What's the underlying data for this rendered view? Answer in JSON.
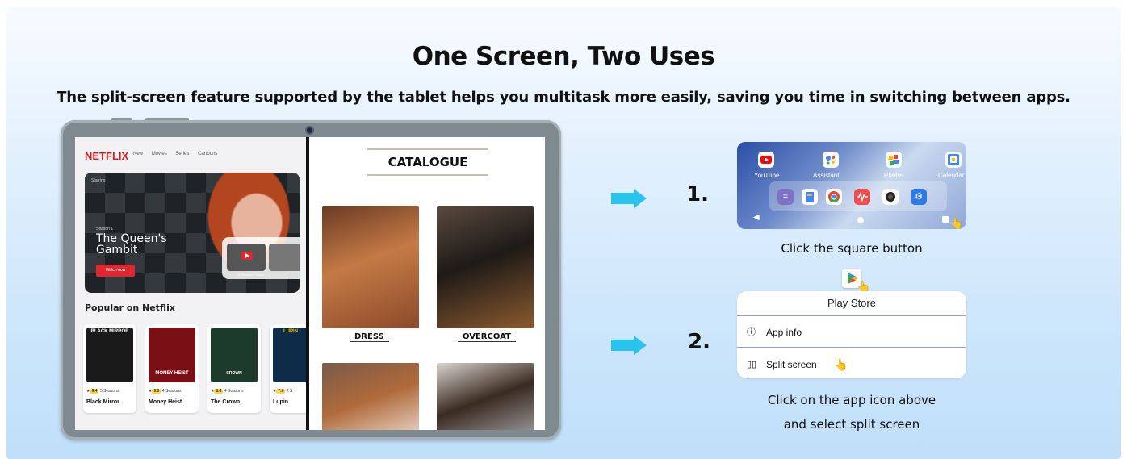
{
  "title": "One Screen, Two Uses",
  "subtitle": "The split-screen feature supported by the tablet helps you multitask more easily, saving you time in switching between apps.",
  "netflix": {
    "logo": "NETFLIX",
    "nav": [
      "New",
      "Movies",
      "Series",
      "Cartoons"
    ],
    "hero_small": "Starring",
    "hero_season": "Season 1",
    "hero_title": "The Queen's Gambit",
    "hero_button": "Watch now",
    "hero_thumb_label": "4. Doubled Pawns",
    "popular_heading": "Popular on Netflix",
    "cards": [
      {
        "poster": "BLACK MIRROR",
        "rating": "9.4",
        "seasons": "5 Seasons",
        "name": "Black Mirror",
        "color": "#1a1a1a"
      },
      {
        "poster": "MONEY HEIST",
        "rating": "9.0",
        "seasons": "4 Seasons",
        "name": "Money Heist",
        "color": "#7a1016"
      },
      {
        "poster": "CROWN",
        "rating": "8.4",
        "seasons": "4 Seasons",
        "name": "The Crown",
        "color": "#1d3b2a"
      },
      {
        "poster": "LUPIN",
        "rating": "7.8",
        "seasons": "2 S",
        "name": "Lupin",
        "color": "#0f2b4a"
      }
    ]
  },
  "catalogue": {
    "title": "CATALOGUE",
    "items": [
      {
        "caption": "DRESS",
        "color": "#b46a3a"
      },
      {
        "caption": "OVERCOAT",
        "color": "#4a3a2c"
      }
    ]
  },
  "steps": [
    {
      "number": "1.",
      "caption": "Click the square button"
    },
    {
      "number": "2.",
      "caption_line1": "Click on the app icon above",
      "caption_line2": "and select split screen"
    }
  ],
  "home_screen": {
    "apps": [
      "YouTube",
      "Assistant",
      "Photos",
      "Calendar"
    ]
  },
  "app_menu": {
    "header": "Play Store",
    "items": [
      {
        "label": "App info",
        "icon": "info-icon"
      },
      {
        "label": "Split screen",
        "icon": "split-screen-icon"
      }
    ]
  },
  "colors": {
    "accent_arrow": "#29c3ef",
    "netflix_red": "#d81f26"
  }
}
